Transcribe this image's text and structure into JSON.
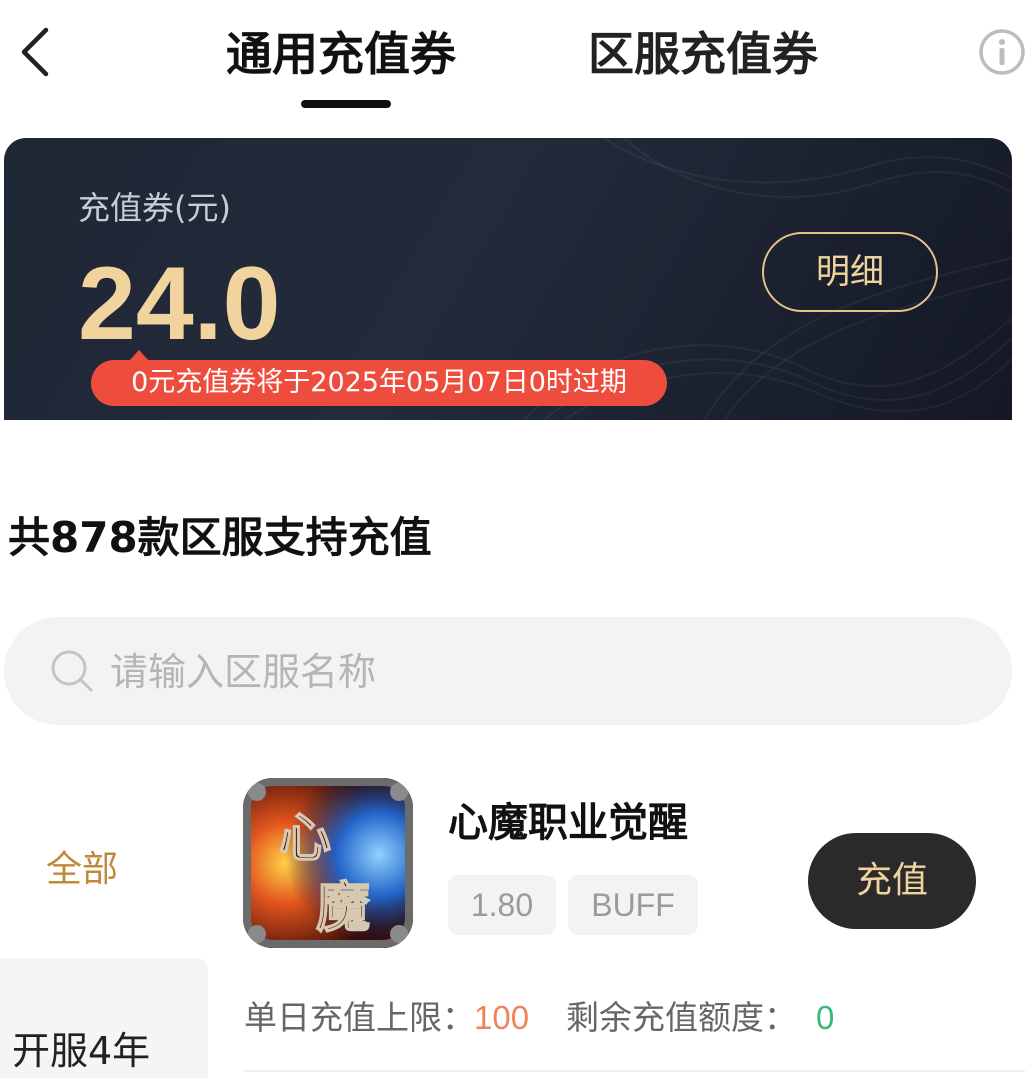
{
  "header": {
    "tabs": [
      {
        "label": "通用充值券",
        "active": true
      },
      {
        "label": "区服充值券",
        "active": false
      }
    ]
  },
  "balance_card": {
    "label": "充值券(元)",
    "amount": "24.0",
    "detail_button": "明细",
    "expire_notice": "0元充值券将于2025年05月07日0时过期"
  },
  "section_title": "共878款区服支持充值",
  "search": {
    "placeholder": "请输入区服名称",
    "value": ""
  },
  "categories": [
    {
      "label": "全部",
      "active": true
    },
    {
      "label": "开服4年",
      "active": false
    }
  ],
  "game": {
    "icon_text": "心魔",
    "title": "心魔职业觉醒",
    "tags": [
      "1.80",
      "BUFF"
    ],
    "recharge_button": "充值",
    "daily_limit_label": "单日充值上限：",
    "daily_limit_value": "100",
    "remaining_label": "剩余充值额度：",
    "remaining_value": "0"
  },
  "colors": {
    "accent_gold": "#f1d49d",
    "alert_red": "#ee4d3d",
    "category_active": "#c08a3c",
    "limit_orange": "#f08358",
    "remaining_green": "#3cb67a"
  },
  "icons": [
    "back-arrow-icon",
    "info-icon",
    "search-icon"
  ]
}
